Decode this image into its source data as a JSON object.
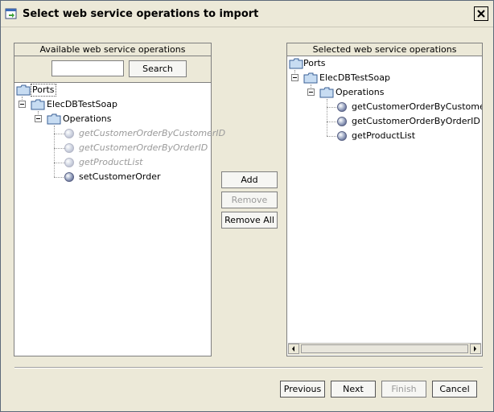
{
  "window": {
    "title": "Select web service operations to import"
  },
  "available": {
    "header": "Available web service operations",
    "search_button": "Search",
    "search_value": "",
    "tree": {
      "root": "Ports",
      "service": "ElecDBTestSoap",
      "operations_folder": "Operations",
      "operations": [
        {
          "name": "getCustomerOrderByCustomerID",
          "disabled": true
        },
        {
          "name": "getCustomerOrderByOrderID",
          "disabled": true
        },
        {
          "name": "getProductList",
          "disabled": true
        },
        {
          "name": "setCustomerOrder",
          "disabled": false
        }
      ]
    }
  },
  "middle_buttons": {
    "add": "Add",
    "remove": "Remove",
    "remove_all": "Remove All"
  },
  "selected": {
    "header": "Selected web service operations",
    "tree": {
      "root": "Ports",
      "service": "ElecDBTestSoap",
      "operations_folder": "Operations",
      "operations": [
        {
          "name": "getCustomerOrderByCustomerID"
        },
        {
          "name": "getCustomerOrderByOrderID"
        },
        {
          "name": "getProductList"
        }
      ]
    }
  },
  "footer": {
    "previous": "Previous",
    "next": "Next",
    "finish": "Finish",
    "cancel": "Cancel"
  },
  "icons": {
    "folder": "folder-icon",
    "operation": "operation-ball-icon",
    "close": "close-icon",
    "window": "import-window-icon"
  }
}
